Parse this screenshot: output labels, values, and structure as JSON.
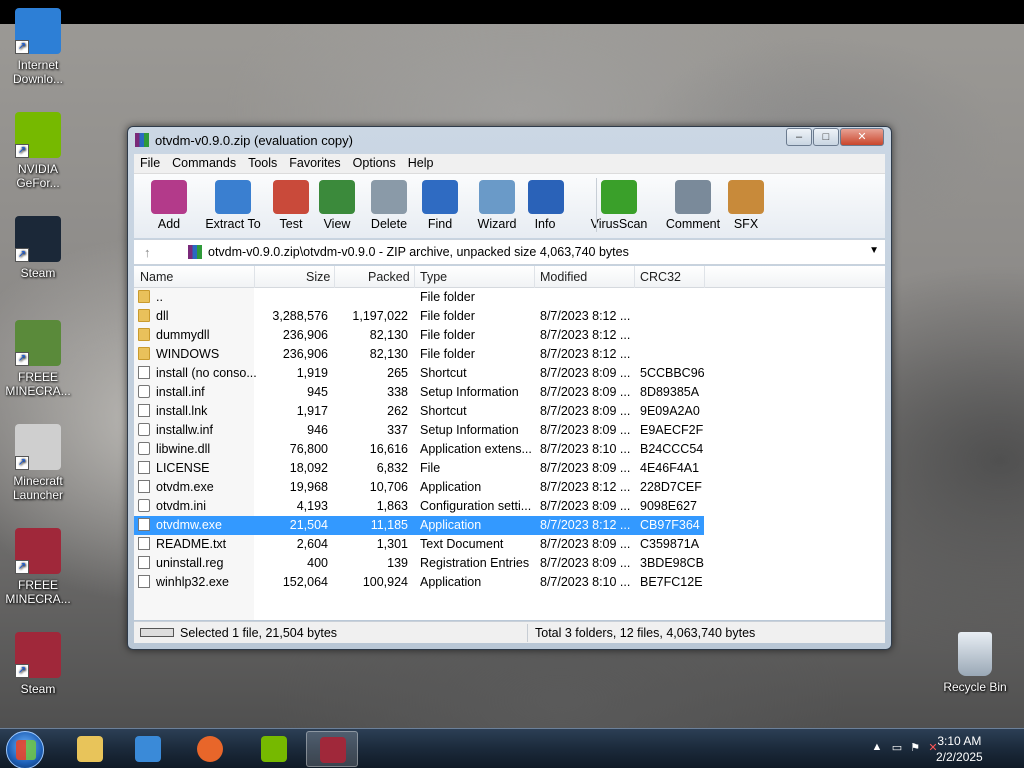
{
  "desktop": {
    "icons": [
      {
        "label": "Internet Downlo...",
        "color": "#2d7fd6"
      },
      {
        "label": "NVIDIA GeFor...",
        "color": "#76b900"
      },
      {
        "label": "Steam",
        "color": "#1b2838"
      },
      {
        "label": "FREEE MINECRA...",
        "color": "#5a8a3a"
      },
      {
        "label": "Minecraft Launcher",
        "color": "#cfcfcf"
      },
      {
        "label": "FREEE MINECRA...",
        "color": "#a0283a"
      },
      {
        "label": "Steam",
        "color": "#a0283a"
      }
    ],
    "recycle_bin": "Recycle Bin"
  },
  "window": {
    "title": "otvdm-v0.9.0.zip (evaluation copy)",
    "controls": {
      "minimize": "–",
      "maximize": "□",
      "close": "✕"
    },
    "menu": [
      "File",
      "Commands",
      "Tools",
      "Favorites",
      "Options",
      "Help"
    ],
    "toolbar": [
      {
        "label": "Add",
        "color": "#b33a8a"
      },
      {
        "label": "Extract To",
        "color": "#3a7fd0"
      },
      {
        "label": "Test",
        "color": "#c94a3a"
      },
      {
        "label": "View",
        "color": "#3b8a3b"
      },
      {
        "label": "Delete",
        "color": "#8a9aa8"
      },
      {
        "label": "Find",
        "color": "#2f6bc2"
      },
      {
        "label": "Wizard",
        "color": "#6a9ac8"
      },
      {
        "label": "Info",
        "color": "#2a62b8"
      },
      {
        "label": "VirusScan",
        "color": "#3aa02a"
      },
      {
        "label": "Comment",
        "color": "#7a8a9a"
      },
      {
        "label": "SFX",
        "color": "#c88a3a"
      }
    ],
    "address": "otvdm-v0.9.0.zip\\otvdm-v0.9.0 - ZIP archive, unpacked size 4,063,740 bytes",
    "columns": {
      "name": "Name",
      "size": "Size",
      "packed": "Packed",
      "type": "Type",
      "modified": "Modified",
      "crc": "CRC32"
    },
    "files": [
      {
        "name": "..",
        "size": "",
        "packed": "",
        "type": "File folder",
        "modified": "",
        "crc": "",
        "icon": "folder"
      },
      {
        "name": "dll",
        "size": "3,288,576",
        "packed": "1,197,022",
        "type": "File folder",
        "modified": "8/7/2023 8:12 ...",
        "crc": "",
        "icon": "folder"
      },
      {
        "name": "dummydll",
        "size": "236,906",
        "packed": "82,130",
        "type": "File folder",
        "modified": "8/7/2023 8:12 ...",
        "crc": "",
        "icon": "folder"
      },
      {
        "name": "WINDOWS",
        "size": "236,906",
        "packed": "82,130",
        "type": "File folder",
        "modified": "8/7/2023 8:12 ...",
        "crc": "",
        "icon": "folder"
      },
      {
        "name": "install (no conso...",
        "size": "1,919",
        "packed": "265",
        "type": "Shortcut",
        "modified": "8/7/2023 8:09 ...",
        "crc": "5CCBBC96",
        "icon": "file"
      },
      {
        "name": "install.inf",
        "size": "945",
        "packed": "338",
        "type": "Setup Information",
        "modified": "8/7/2023 8:09 ...",
        "crc": "8D89385A",
        "icon": "gear"
      },
      {
        "name": "install.lnk",
        "size": "1,917",
        "packed": "262",
        "type": "Shortcut",
        "modified": "8/7/2023 8:09 ...",
        "crc": "9E09A2A0",
        "icon": "file"
      },
      {
        "name": "installw.inf",
        "size": "946",
        "packed": "337",
        "type": "Setup Information",
        "modified": "8/7/2023 8:09 ...",
        "crc": "E9AECF2F",
        "icon": "gear"
      },
      {
        "name": "libwine.dll",
        "size": "76,800",
        "packed": "16,616",
        "type": "Application extens...",
        "modified": "8/7/2023 8:10 ...",
        "crc": "B24CCC54",
        "icon": "gear"
      },
      {
        "name": "LICENSE",
        "size": "18,092",
        "packed": "6,832",
        "type": "File",
        "modified": "8/7/2023 8:09 ...",
        "crc": "4E46F4A1",
        "icon": "file"
      },
      {
        "name": "otvdm.exe",
        "size": "19,968",
        "packed": "10,706",
        "type": "Application",
        "modified": "8/7/2023 8:12 ...",
        "crc": "228D7CEF",
        "icon": "file"
      },
      {
        "name": "otvdm.ini",
        "size": "4,193",
        "packed": "1,863",
        "type": "Configuration setti...",
        "modified": "8/7/2023 8:09 ...",
        "crc": "9098E627",
        "icon": "gear"
      },
      {
        "name": "otvdmw.exe",
        "size": "21,504",
        "packed": "11,185",
        "type": "Application",
        "modified": "8/7/2023 8:12 ...",
        "crc": "CB97F364",
        "icon": "file",
        "selected": true
      },
      {
        "name": "README.txt",
        "size": "2,604",
        "packed": "1,301",
        "type": "Text Document",
        "modified": "8/7/2023 8:09 ...",
        "crc": "C359871A",
        "icon": "file"
      },
      {
        "name": "uninstall.reg",
        "size": "400",
        "packed": "139",
        "type": "Registration Entries",
        "modified": "8/7/2023 8:09 ...",
        "crc": "3BDE98CB",
        "icon": "file"
      },
      {
        "name": "winhlp32.exe",
        "size": "152,064",
        "packed": "100,924",
        "type": "Application",
        "modified": "8/7/2023 8:10 ...",
        "crc": "BE7FC12E",
        "icon": "file"
      }
    ],
    "status_left": "Selected 1 file, 21,504 bytes",
    "status_right": "Total 3 folders, 12 files, 4,063,740 bytes"
  },
  "taskbar": {
    "apps": [
      {
        "name": "explorer",
        "color": "#e8c45a"
      },
      {
        "name": "media-player",
        "color": "#3a8ad8"
      },
      {
        "name": "firefox",
        "color": "#e8662a"
      },
      {
        "name": "nvidia",
        "color": "#76b900"
      },
      {
        "name": "winrar",
        "color": "#a0283a",
        "active": true
      }
    ],
    "time": "3:10 AM",
    "date": "2/2/2025"
  }
}
